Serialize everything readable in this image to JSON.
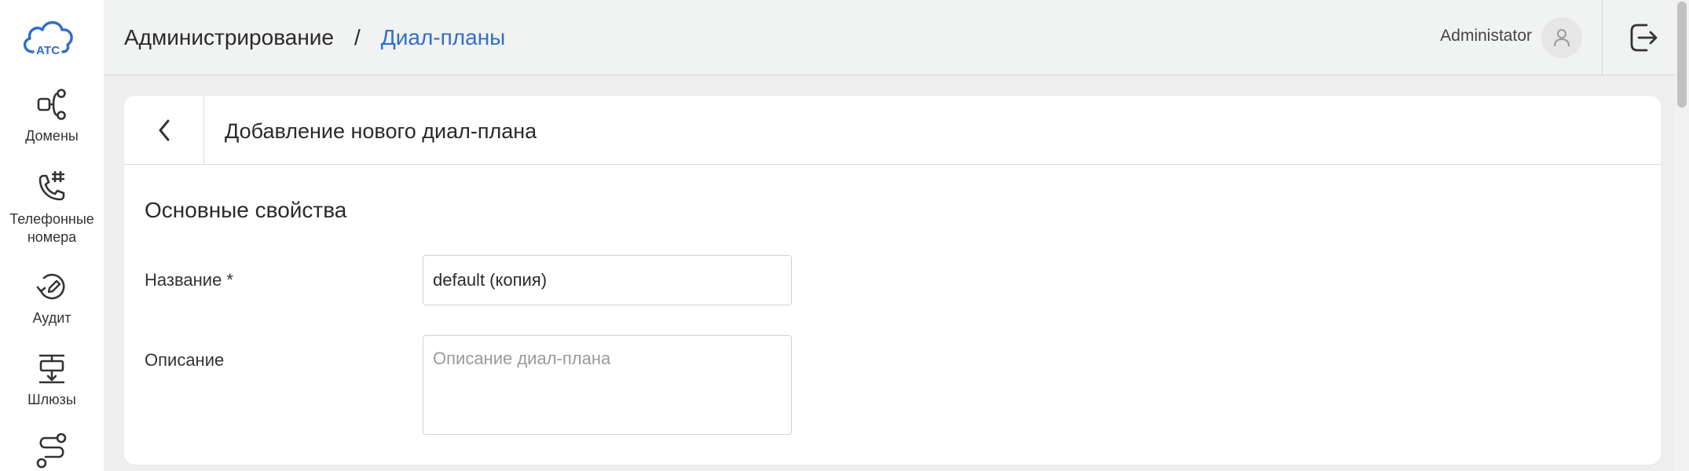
{
  "app": {
    "logo_text": "АТС"
  },
  "sidebar": {
    "items": [
      {
        "label": "Домены",
        "icon": "domains-icon"
      },
      {
        "label": "Телефонные номера",
        "icon": "phone-numbers-icon"
      },
      {
        "label": "Аудит",
        "icon": "audit-icon"
      },
      {
        "label": "Шлюзы",
        "icon": "gateways-icon"
      },
      {
        "label": "",
        "icon": "routes-icon"
      }
    ]
  },
  "header": {
    "breadcrumb_root": "Администрирование",
    "breadcrumb_separator": "/",
    "breadcrumb_current": "Диал-планы",
    "user_name": "Administator"
  },
  "card": {
    "title": "Добавление нового диал-плана",
    "section_title": "Основные свойства",
    "fields": {
      "name": {
        "label": "Название *",
        "value": "default (копия)"
      },
      "description": {
        "label": "Описание",
        "placeholder": "Описание диал-плана",
        "value": ""
      }
    }
  },
  "colors": {
    "accent": "#2f6fc8",
    "header_bg": "#f1f2f2",
    "page_bg": "#eeeeee"
  }
}
